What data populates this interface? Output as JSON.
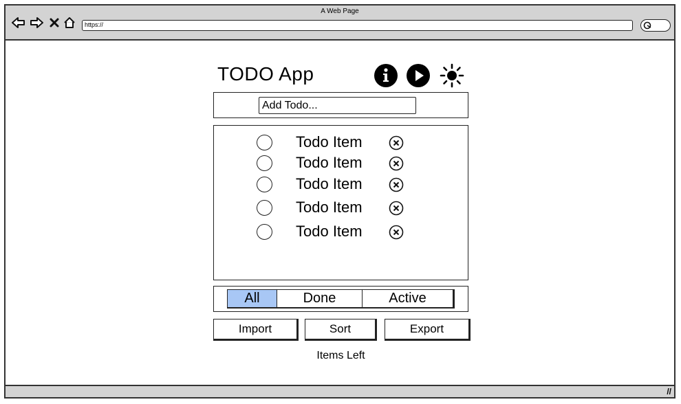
{
  "browser": {
    "window_title": "A Web Page",
    "url": "https://",
    "nav_icons": [
      "back-arrow-icon",
      "forward-arrow-icon",
      "close-x-icon",
      "home-icon"
    ]
  },
  "app": {
    "title": "TODO App",
    "header_icons": [
      "info-icon",
      "play-icon",
      "sun-icon"
    ]
  },
  "add_todo": {
    "placeholder": "Add Todo...",
    "value": ""
  },
  "todos": [
    {
      "label": "Todo Item",
      "done": false
    },
    {
      "label": "Todo Item",
      "done": false
    },
    {
      "label": "Todo Item",
      "done": false
    },
    {
      "label": "Todo Item",
      "done": false
    },
    {
      "label": "Todo Item",
      "done": false
    }
  ],
  "filters": {
    "items": [
      "All",
      "Done",
      "Active"
    ],
    "selected": "All"
  },
  "actions": {
    "import_label": "Import",
    "sort_label": "Sort",
    "export_label": "Export"
  },
  "footer": {
    "items_left_label": "Items Left"
  },
  "colors": {
    "chrome_gray": "#d3d3d3",
    "active_filter": "#a8c7f5",
    "ink": "#000000"
  }
}
